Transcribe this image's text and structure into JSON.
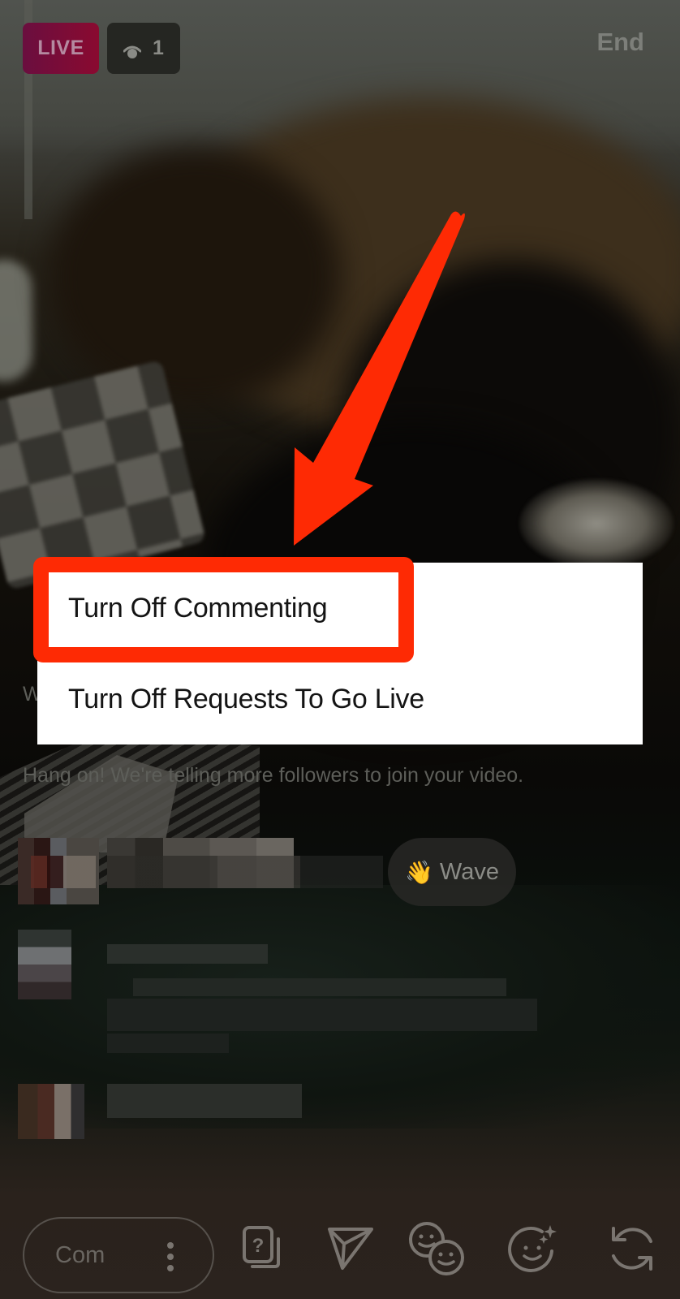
{
  "header": {
    "live_label": "LIVE",
    "viewer_count": "1",
    "end_label": "End"
  },
  "status": {
    "welcome_partial": "W vi",
    "waiting_message": "Hang on! We're telling more followers to join your video."
  },
  "options_menu": {
    "items": [
      {
        "label": "Turn Off Commenting",
        "highlighted": true
      },
      {
        "label": "Turn Off Requests To Go Live",
        "highlighted": false
      }
    ]
  },
  "comments": {
    "wave_label": "Wave",
    "wave_emoji": "👋",
    "rows_pixelated": 3
  },
  "toolbar": {
    "comment_placeholder": "Comment",
    "comment_visible_text": "Com",
    "icons": [
      "more-options-icon",
      "question-card-icon",
      "send-icon",
      "invite-guest-icon",
      "face-effects-icon",
      "flip-camera-icon"
    ]
  },
  "annotation": {
    "color": "#fe2a04",
    "target": "Turn Off Commenting"
  },
  "colors": {
    "live_badge": "#7a0c38",
    "viewer_badge": "#252622",
    "menu_bg": "#ffffff",
    "menu_text": "#141414",
    "annotation_red": "#fe2a04"
  }
}
